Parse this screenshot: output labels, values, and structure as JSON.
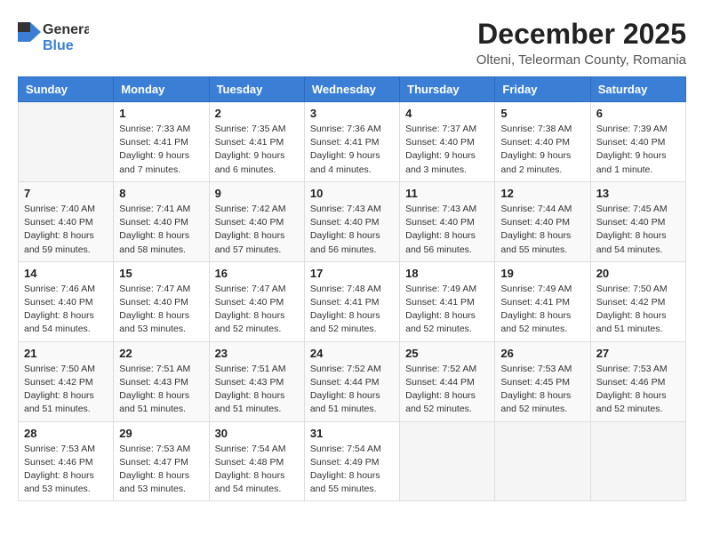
{
  "header": {
    "logo_general": "General",
    "logo_blue": "Blue",
    "month_title": "December 2025",
    "subtitle": "Olteni, Teleorman County, Romania"
  },
  "weekdays": [
    "Sunday",
    "Monday",
    "Tuesday",
    "Wednesday",
    "Thursday",
    "Friday",
    "Saturday"
  ],
  "weeks": [
    [
      {
        "day": "",
        "info": ""
      },
      {
        "day": "1",
        "info": "Sunrise: 7:33 AM\nSunset: 4:41 PM\nDaylight: 9 hours\nand 7 minutes."
      },
      {
        "day": "2",
        "info": "Sunrise: 7:35 AM\nSunset: 4:41 PM\nDaylight: 9 hours\nand 6 minutes."
      },
      {
        "day": "3",
        "info": "Sunrise: 7:36 AM\nSunset: 4:41 PM\nDaylight: 9 hours\nand 4 minutes."
      },
      {
        "day": "4",
        "info": "Sunrise: 7:37 AM\nSunset: 4:40 PM\nDaylight: 9 hours\nand 3 minutes."
      },
      {
        "day": "5",
        "info": "Sunrise: 7:38 AM\nSunset: 4:40 PM\nDaylight: 9 hours\nand 2 minutes."
      },
      {
        "day": "6",
        "info": "Sunrise: 7:39 AM\nSunset: 4:40 PM\nDaylight: 9 hours\nand 1 minute."
      }
    ],
    [
      {
        "day": "7",
        "info": "Sunrise: 7:40 AM\nSunset: 4:40 PM\nDaylight: 8 hours\nand 59 minutes."
      },
      {
        "day": "8",
        "info": "Sunrise: 7:41 AM\nSunset: 4:40 PM\nDaylight: 8 hours\nand 58 minutes."
      },
      {
        "day": "9",
        "info": "Sunrise: 7:42 AM\nSunset: 4:40 PM\nDaylight: 8 hours\nand 57 minutes."
      },
      {
        "day": "10",
        "info": "Sunrise: 7:43 AM\nSunset: 4:40 PM\nDaylight: 8 hours\nand 56 minutes."
      },
      {
        "day": "11",
        "info": "Sunrise: 7:43 AM\nSunset: 4:40 PM\nDaylight: 8 hours\nand 56 minutes."
      },
      {
        "day": "12",
        "info": "Sunrise: 7:44 AM\nSunset: 4:40 PM\nDaylight: 8 hours\nand 55 minutes."
      },
      {
        "day": "13",
        "info": "Sunrise: 7:45 AM\nSunset: 4:40 PM\nDaylight: 8 hours\nand 54 minutes."
      }
    ],
    [
      {
        "day": "14",
        "info": "Sunrise: 7:46 AM\nSunset: 4:40 PM\nDaylight: 8 hours\nand 54 minutes."
      },
      {
        "day": "15",
        "info": "Sunrise: 7:47 AM\nSunset: 4:40 PM\nDaylight: 8 hours\nand 53 minutes."
      },
      {
        "day": "16",
        "info": "Sunrise: 7:47 AM\nSunset: 4:40 PM\nDaylight: 8 hours\nand 52 minutes."
      },
      {
        "day": "17",
        "info": "Sunrise: 7:48 AM\nSunset: 4:41 PM\nDaylight: 8 hours\nand 52 minutes."
      },
      {
        "day": "18",
        "info": "Sunrise: 7:49 AM\nSunset: 4:41 PM\nDaylight: 8 hours\nand 52 minutes."
      },
      {
        "day": "19",
        "info": "Sunrise: 7:49 AM\nSunset: 4:41 PM\nDaylight: 8 hours\nand 52 minutes."
      },
      {
        "day": "20",
        "info": "Sunrise: 7:50 AM\nSunset: 4:42 PM\nDaylight: 8 hours\nand 51 minutes."
      }
    ],
    [
      {
        "day": "21",
        "info": "Sunrise: 7:50 AM\nSunset: 4:42 PM\nDaylight: 8 hours\nand 51 minutes."
      },
      {
        "day": "22",
        "info": "Sunrise: 7:51 AM\nSunset: 4:43 PM\nDaylight: 8 hours\nand 51 minutes."
      },
      {
        "day": "23",
        "info": "Sunrise: 7:51 AM\nSunset: 4:43 PM\nDaylight: 8 hours\nand 51 minutes."
      },
      {
        "day": "24",
        "info": "Sunrise: 7:52 AM\nSunset: 4:44 PM\nDaylight: 8 hours\nand 51 minutes."
      },
      {
        "day": "25",
        "info": "Sunrise: 7:52 AM\nSunset: 4:44 PM\nDaylight: 8 hours\nand 52 minutes."
      },
      {
        "day": "26",
        "info": "Sunrise: 7:53 AM\nSunset: 4:45 PM\nDaylight: 8 hours\nand 52 minutes."
      },
      {
        "day": "27",
        "info": "Sunrise: 7:53 AM\nSunset: 4:46 PM\nDaylight: 8 hours\nand 52 minutes."
      }
    ],
    [
      {
        "day": "28",
        "info": "Sunrise: 7:53 AM\nSunset: 4:46 PM\nDaylight: 8 hours\nand 53 minutes."
      },
      {
        "day": "29",
        "info": "Sunrise: 7:53 AM\nSunset: 4:47 PM\nDaylight: 8 hours\nand 53 minutes."
      },
      {
        "day": "30",
        "info": "Sunrise: 7:54 AM\nSunset: 4:48 PM\nDaylight: 8 hours\nand 54 minutes."
      },
      {
        "day": "31",
        "info": "Sunrise: 7:54 AM\nSunset: 4:49 PM\nDaylight: 8 hours\nand 55 minutes."
      },
      {
        "day": "",
        "info": ""
      },
      {
        "day": "",
        "info": ""
      },
      {
        "day": "",
        "info": ""
      }
    ]
  ]
}
